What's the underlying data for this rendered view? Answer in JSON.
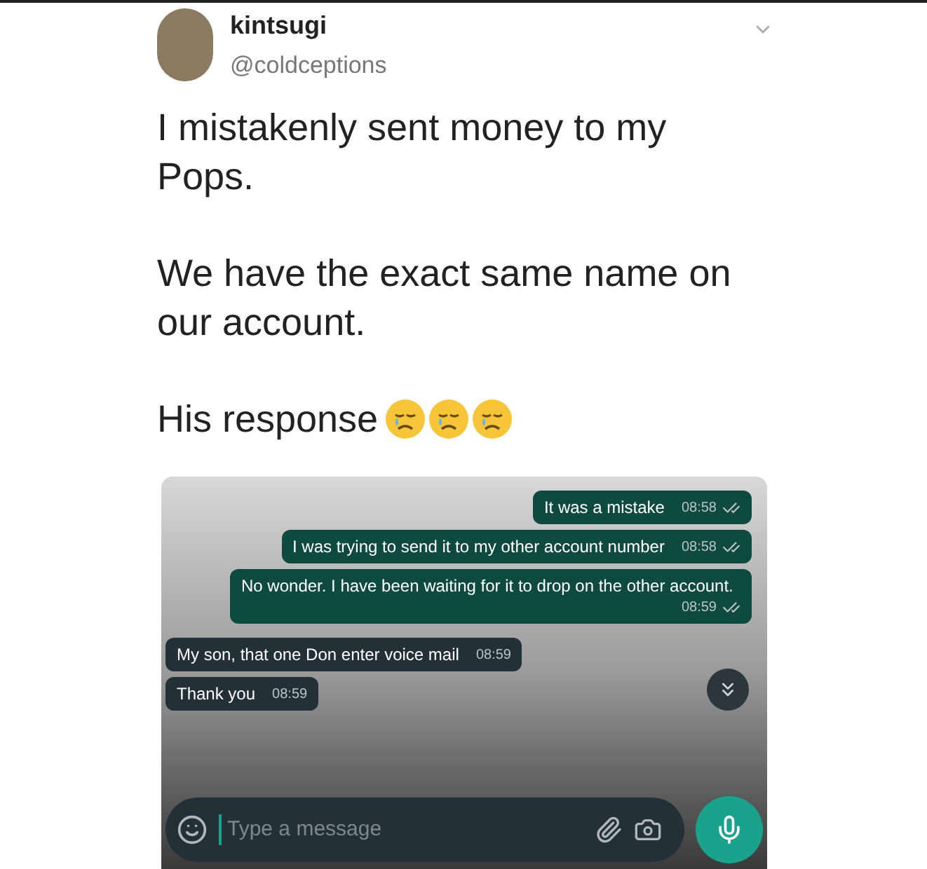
{
  "tweet": {
    "author": {
      "name": "kintsugi",
      "handle": "@coldceptions"
    },
    "paragraphs": [
      "I mistakenly sent money to my Pops.",
      "We have the exact same name on our account.",
      "His response"
    ]
  },
  "chat": {
    "messages": [
      {
        "kind": "sent",
        "text": "It was a mistake",
        "time": "08:58"
      },
      {
        "kind": "sent",
        "text": "I was trying to send it to my other account number",
        "time": "08:58"
      },
      {
        "kind": "sent",
        "text": "No wonder. I have been waiting for it to drop on the other account.",
        "time": "08:59"
      },
      {
        "kind": "received",
        "text": "My son, that one Don enter voice mail",
        "time": "08:59"
      },
      {
        "kind": "received",
        "text": "Thank you",
        "time": "08:59"
      }
    ],
    "input": {
      "placeholder": "Type a message"
    }
  }
}
